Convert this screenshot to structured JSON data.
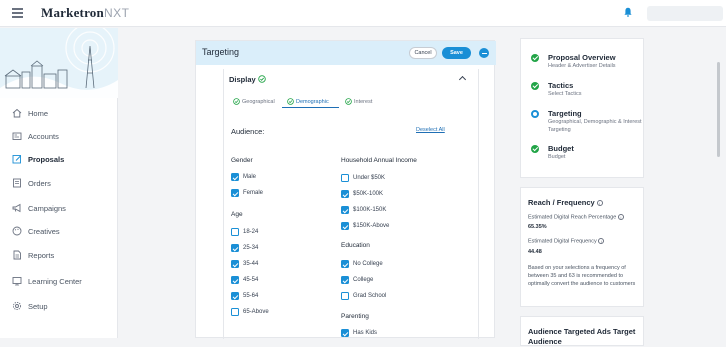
{
  "app": {
    "brand": "Marketron",
    "brand_suffix": "NXT"
  },
  "sidebar": {
    "items": [
      {
        "label": "Home",
        "icon": "home-icon"
      },
      {
        "label": "Accounts",
        "icon": "accounts-icon"
      },
      {
        "label": "Proposals",
        "icon": "proposals-icon",
        "active": true
      },
      {
        "label": "Orders",
        "icon": "orders-icon"
      },
      {
        "label": "Campaigns",
        "icon": "megaphone-icon"
      },
      {
        "label": "Creatives",
        "icon": "palette-icon"
      },
      {
        "label": "Reports",
        "icon": "reports-icon"
      },
      {
        "label": "Learning Center",
        "icon": "learning-icon"
      },
      {
        "label": "Setup",
        "icon": "gear-icon"
      }
    ]
  },
  "targeting": {
    "title": "Targeting",
    "cancel_label": "Cancel",
    "save_label": "Save",
    "display_title": "Display",
    "tabs": [
      "Geographical",
      "Demographic",
      "Interest"
    ],
    "active_tab": "Demographic",
    "audience_label": "Audience:",
    "deselect_label": "Deselect All",
    "gender": {
      "heading": "Gender",
      "options": [
        {
          "label": "Male",
          "checked": true
        },
        {
          "label": "Female",
          "checked": true
        }
      ]
    },
    "age": {
      "heading": "Age",
      "options": [
        {
          "label": "18-24",
          "checked": false
        },
        {
          "label": "25-34",
          "checked": true
        },
        {
          "label": "35-44",
          "checked": true
        },
        {
          "label": "45-54",
          "checked": true
        },
        {
          "label": "55-64",
          "checked": true
        },
        {
          "label": "65-Above",
          "checked": false
        }
      ]
    },
    "income": {
      "heading": "Household Annual Income",
      "options": [
        {
          "label": "Under $50K",
          "checked": false
        },
        {
          "label": "$50K-100K",
          "checked": true
        },
        {
          "label": "$100K-150K",
          "checked": true
        },
        {
          "label": "$150K-Above",
          "checked": true
        }
      ]
    },
    "education": {
      "heading": "Education",
      "options": [
        {
          "label": "No College",
          "checked": true
        },
        {
          "label": "College",
          "checked": true
        },
        {
          "label": "Grad School",
          "checked": false
        }
      ]
    },
    "parenting": {
      "heading": "Parenting",
      "options": [
        {
          "label": "Has Kids",
          "checked": true
        }
      ]
    }
  },
  "steps": [
    {
      "title": "Proposal Overview",
      "desc": "Header & Advertiser Details",
      "status": "done"
    },
    {
      "title": "Tactics",
      "desc": "Select Tactics",
      "status": "done"
    },
    {
      "title": "Targeting",
      "desc": "Geographical, Demographic & Interest Targeting",
      "status": "current"
    },
    {
      "title": "Budget",
      "desc": "Budget",
      "status": "done"
    }
  ],
  "reach": {
    "title": "Reach / Frequency",
    "reach_label": "Estimated Digital Reach Percentage",
    "reach_value": "65.35%",
    "freq_label": "Estimated Digital Frequency",
    "freq_value": "44.48",
    "note": "Based on your selections a frequency of between 35 and 63 is recommended to optimally convert the audience to customers"
  },
  "audience_card": {
    "title": "Audience Targeted Ads Target Audience"
  },
  "colors": {
    "accent": "#1a8fd6",
    "success": "#22a447",
    "header_bg": "#daeefa"
  }
}
